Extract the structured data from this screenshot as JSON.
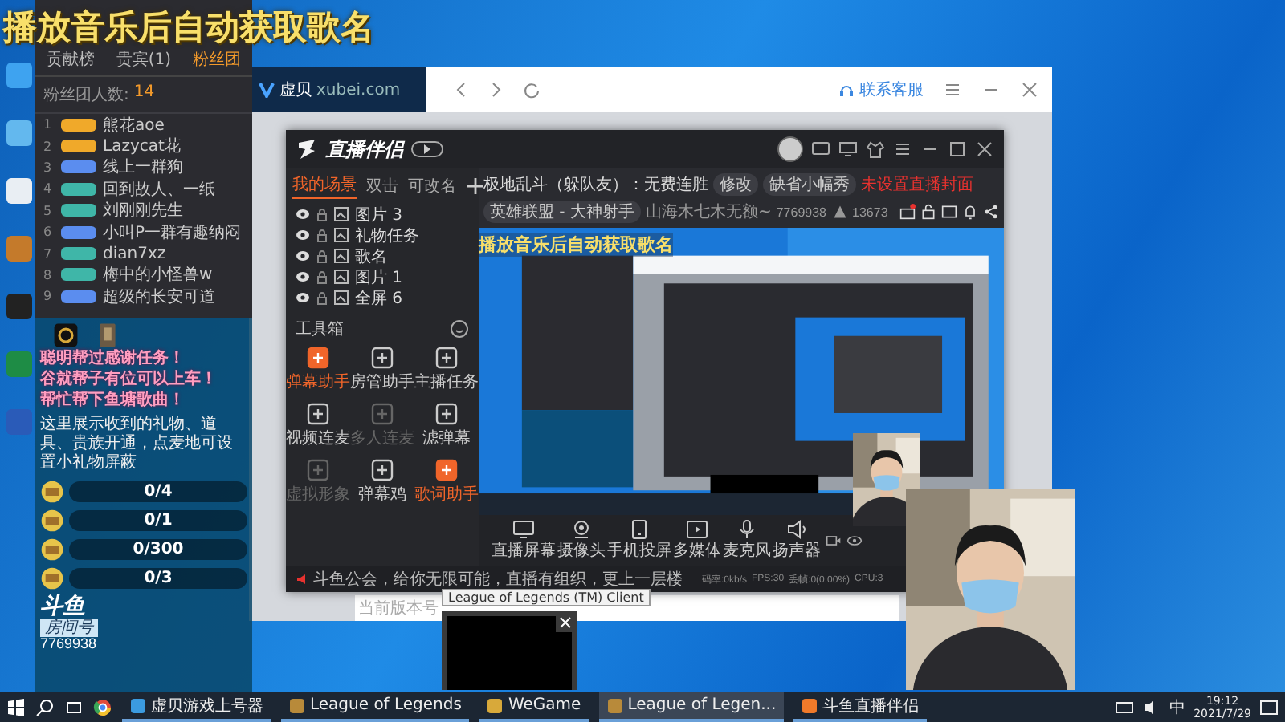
{
  "overlay_title": "播放音乐后自动获取歌名",
  "fan_panel": {
    "tabs": [
      {
        "label": "贡献榜",
        "selected": false
      },
      {
        "label": "贵宾(1)",
        "selected": false
      },
      {
        "label": "粉丝团",
        "selected": true
      }
    ],
    "member_count_label": "粉丝团人数:",
    "member_count": "14",
    "rows": [
      {
        "rank": "1",
        "name": "熊花aoe",
        "color": "#f0a92a"
      },
      {
        "rank": "2",
        "name": "Lazycat花",
        "color": "#f0a92a"
      },
      {
        "rank": "3",
        "name": "线上一群狗",
        "color": "#5b8def"
      },
      {
        "rank": "4",
        "name": "回到故人、一纸",
        "color": "#3fb6a8"
      },
      {
        "rank": "5",
        "name": "刘刚刚先生",
        "color": "#3fb6a8"
      },
      {
        "rank": "6",
        "name": "小叫P一群有趣纳闷",
        "color": "#5b8def"
      },
      {
        "rank": "7",
        "name": "dian7xz",
        "color": "#3fb6a8"
      },
      {
        "rank": "8",
        "name": "梅中的小怪兽w",
        "color": "#3fb6a8"
      },
      {
        "rank": "9",
        "name": "超级的长安可道",
        "color": "#5b8def"
      }
    ]
  },
  "task_panel": {
    "notices": [
      "聪明帮过感谢任务！",
      "谷就帮子有位可以上车！",
      "帮忙帮下鱼塘歌曲！"
    ],
    "gift_hint": "这里展示收到的礼物、道具、贵族开通，点麦地可设置小礼物屏蔽",
    "tasks": [
      {
        "progress": "0/4"
      },
      {
        "progress": "0/1"
      },
      {
        "progress": "0/300"
      },
      {
        "progress": "0/3"
      }
    ],
    "logo": "斗鱼",
    "room_label": "房间号",
    "room_number": "7769938"
  },
  "browser": {
    "site": "虚贝",
    "domain": "xubei.com",
    "support": "联系客服",
    "footer_note": "当前版本号"
  },
  "studio": {
    "title": "直播伴侣",
    "scene_tabs": [
      {
        "label": "我的场景",
        "selected": true
      },
      {
        "label": "双击",
        "selected": false
      },
      {
        "label": "可改名",
        "selected": false
      }
    ],
    "scenes": [
      {
        "name": "图片 3"
      },
      {
        "name": "礼物任务"
      },
      {
        "name": "歌名"
      },
      {
        "name": "图片 1"
      },
      {
        "name": "全屏 6"
      }
    ],
    "toolbox_title": "工具箱",
    "tools": [
      {
        "label": "弹幕助手",
        "active": true,
        "disabled": false
      },
      {
        "label": "房管助手",
        "active": false,
        "disabled": false
      },
      {
        "label": "主播任务",
        "active": false,
        "disabled": false
      },
      {
        "label": "视频连麦",
        "active": false,
        "disabled": false
      },
      {
        "label": "多人连麦",
        "active": false,
        "disabled": true
      },
      {
        "label": "滤弹幕",
        "active": false,
        "disabled": false
      },
      {
        "label": "虚拟形象",
        "active": false,
        "disabled": true
      },
      {
        "label": "弹幕鸡",
        "active": false,
        "disabled": false
      },
      {
        "label": "歌词助手",
        "active": true,
        "disabled": false
      }
    ],
    "stream_title": "极地乱斗（躲队友）：无费连胜",
    "edit": "修改",
    "category_field": "缺省小幅秀",
    "warning": "未设置直播封面",
    "game": "英雄联盟 - 大神射手",
    "anchor": "山海木七木无额~",
    "room": "7769938",
    "viewers": "13673",
    "preview_caption": "播放音乐后自动获取歌名",
    "controls": [
      "直播屏幕",
      "摄像头",
      "手机投屏",
      "多媒体",
      "麦克风",
      "扬声器"
    ],
    "announcement": "斗鱼公会，给你无限可能，直播有组织，更上一层楼",
    "stats": [
      "码率:0kb/s",
      "FPS:30",
      "丢帧:0(0.00%)",
      "CPU:3"
    ]
  },
  "tooltip": "League of Legends (TM) Client",
  "taskbar": {
    "apps": [
      {
        "label": "虚贝游戏上号器",
        "selected": false
      },
      {
        "label": "League of Legends",
        "selected": false
      },
      {
        "label": "WeGame",
        "selected": false
      },
      {
        "label": "League of Legen...",
        "selected": true
      },
      {
        "label": "斗鱼直播伴侣",
        "selected": false
      }
    ],
    "input_method": "中",
    "time": "19:12",
    "date": "2021/7/29"
  }
}
